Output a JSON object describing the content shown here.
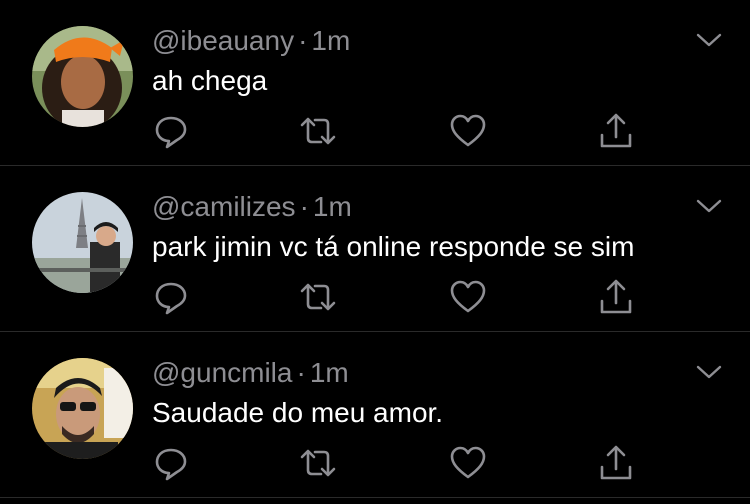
{
  "tweets": [
    {
      "handle": "@ibeauany",
      "separator": "·",
      "time": "1m",
      "text": "ah chega"
    },
    {
      "handle": "@camilizes",
      "separator": "·",
      "time": "1m",
      "text": "park jimin vc tá online responde se sim"
    },
    {
      "handle": "@guncmila",
      "separator": "·",
      "time": "1m",
      "text": "Saudade do meu amor."
    }
  ],
  "icons": {
    "chevron": "chevron-down-icon",
    "reply": "reply-icon",
    "retweet": "retweet-icon",
    "like": "heart-icon",
    "share": "share-icon"
  },
  "colors": {
    "background": "#000000",
    "text": "#ffffff",
    "secondary": "#8e8e93",
    "divider": "#2a2a2a"
  }
}
